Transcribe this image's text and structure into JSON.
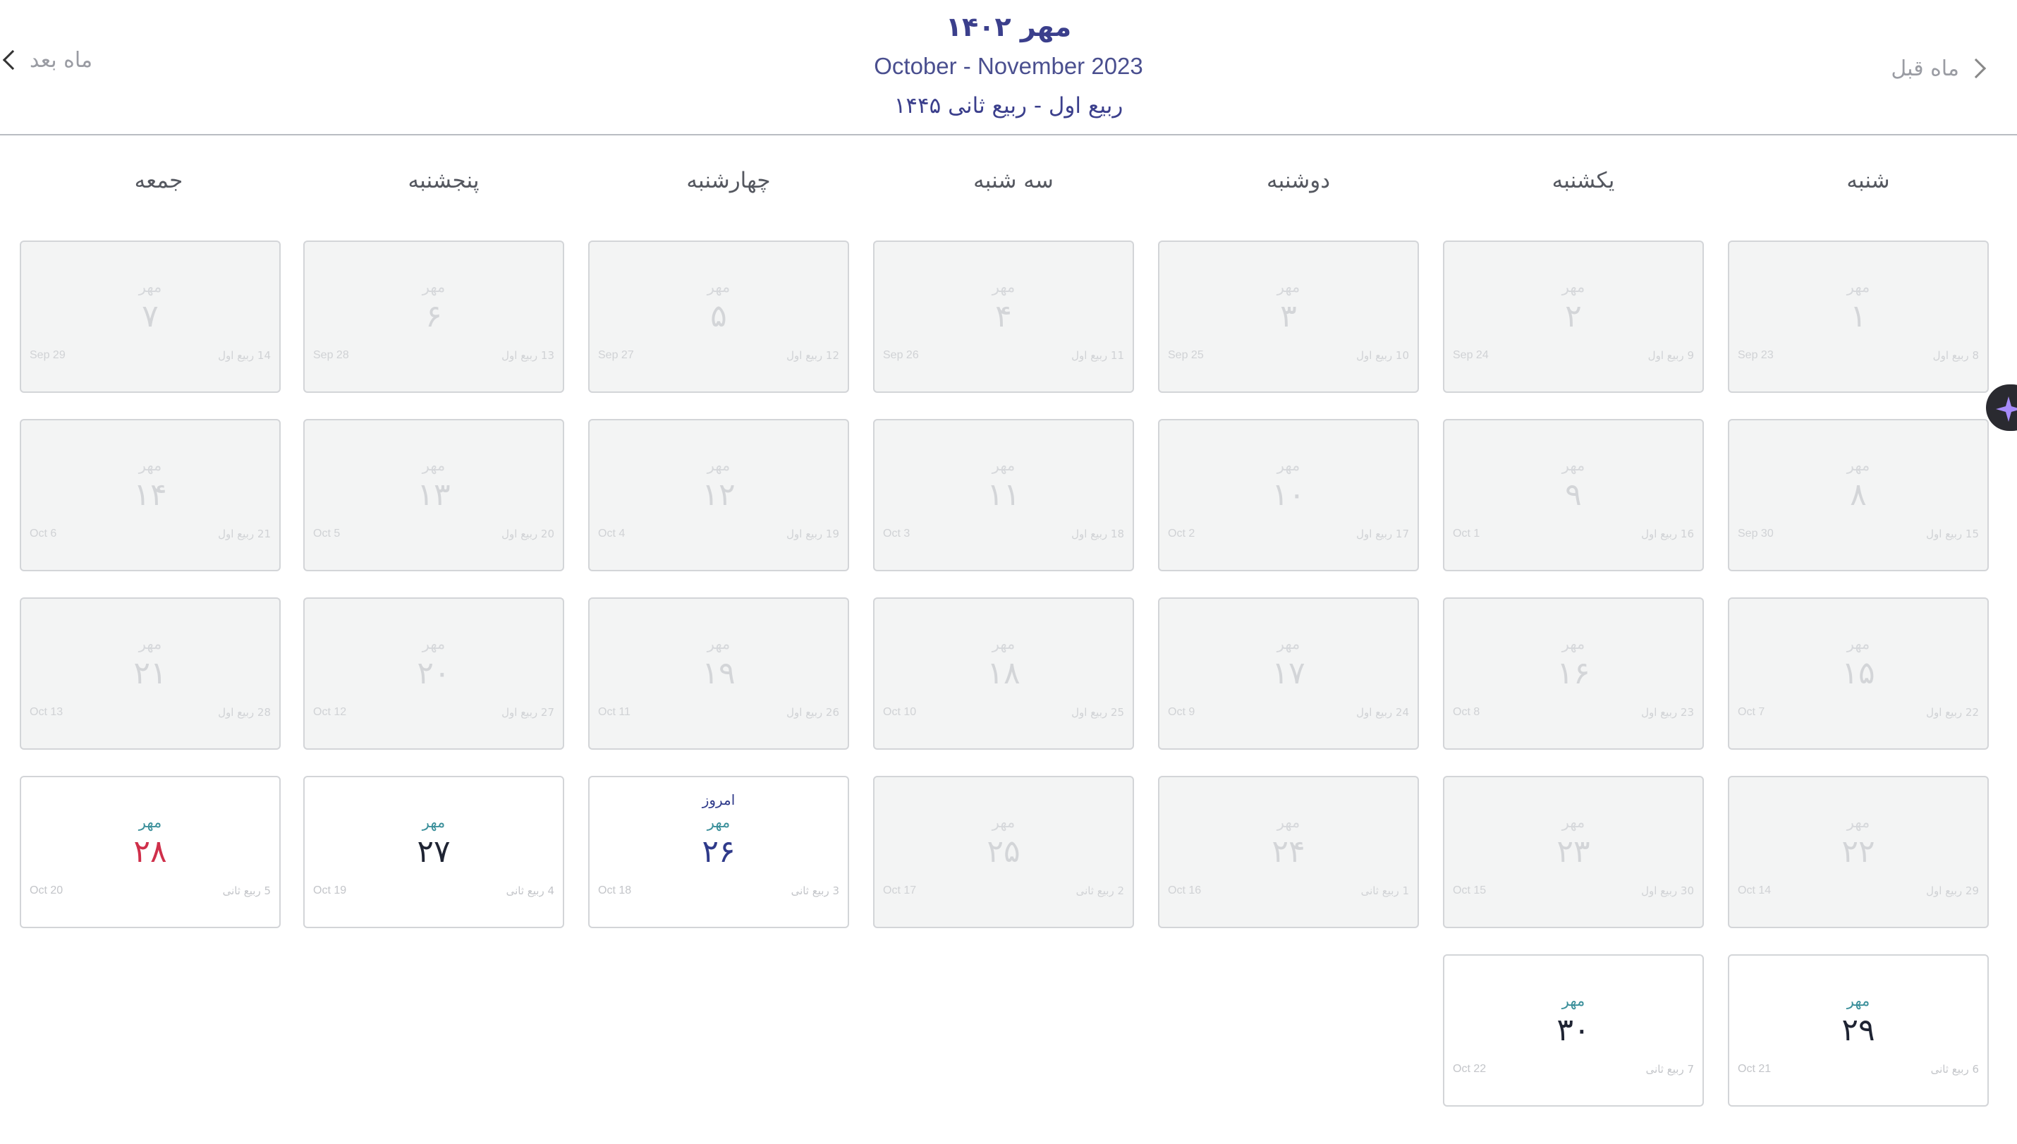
{
  "header": {
    "persian_title": "مهر ۱۴۰۲",
    "gregorian_range": "October - November 2023",
    "hijri_range": "ربیع اول - ربیع ثانی ۱۴۴۵",
    "next_month_label": "ماه بعد",
    "prev_month_label": "ماه قبل"
  },
  "weekdays": [
    "شنبه",
    "یکشنبه",
    "دوشنبه",
    "سه شنبه",
    "چهارشنبه",
    "پنجشنبه",
    "جمعه"
  ],
  "month_name": "مهر",
  "today_label": "امروز",
  "fab_icon": "sparkle-icon",
  "colors": {
    "accent": "#2f3a8a",
    "month_label": "#3a8f9a",
    "holiday": "#cf2f4a",
    "past_bg": "#f3f4f4"
  },
  "days": [
    {
      "day": "۱",
      "greg": "Sep 23",
      "hijri": "8 ربیع اول",
      "past": true
    },
    {
      "day": "۲",
      "greg": "Sep 24",
      "hijri": "9 ربیع اول",
      "past": true
    },
    {
      "day": "۳",
      "greg": "Sep 25",
      "hijri": "10 ربیع اول",
      "past": true
    },
    {
      "day": "۴",
      "greg": "Sep 26",
      "hijri": "11 ربیع اول",
      "past": true
    },
    {
      "day": "۵",
      "greg": "Sep 27",
      "hijri": "12 ربیع اول",
      "past": true
    },
    {
      "day": "۶",
      "greg": "Sep 28",
      "hijri": "13 ربیع اول",
      "past": true
    },
    {
      "day": "۷",
      "greg": "Sep 29",
      "hijri": "14 ربیع اول",
      "past": true
    },
    {
      "day": "۸",
      "greg": "Sep 30",
      "hijri": "15 ربیع اول",
      "past": true
    },
    {
      "day": "۹",
      "greg": "Oct 1",
      "hijri": "16 ربیع اول",
      "past": true
    },
    {
      "day": "۱۰",
      "greg": "Oct 2",
      "hijri": "17 ربیع اول",
      "past": true
    },
    {
      "day": "۱۱",
      "greg": "Oct 3",
      "hijri": "18 ربیع اول",
      "past": true
    },
    {
      "day": "۱۲",
      "greg": "Oct 4",
      "hijri": "19 ربیع اول",
      "past": true
    },
    {
      "day": "۱۳",
      "greg": "Oct 5",
      "hijri": "20 ربیع اول",
      "past": true
    },
    {
      "day": "۱۴",
      "greg": "Oct 6",
      "hijri": "21 ربیع اول",
      "past": true
    },
    {
      "day": "۱۵",
      "greg": "Oct 7",
      "hijri": "22 ربیع اول",
      "past": true
    },
    {
      "day": "۱۶",
      "greg": "Oct 8",
      "hijri": "23 ربیع اول",
      "past": true
    },
    {
      "day": "۱۷",
      "greg": "Oct 9",
      "hijri": "24 ربیع اول",
      "past": true
    },
    {
      "day": "۱۸",
      "greg": "Oct 10",
      "hijri": "25 ربیع اول",
      "past": true
    },
    {
      "day": "۱۹",
      "greg": "Oct 11",
      "hijri": "26 ربیع اول",
      "past": true
    },
    {
      "day": "۲۰",
      "greg": "Oct 12",
      "hijri": "27 ربیع اول",
      "past": true
    },
    {
      "day": "۲۱",
      "greg": "Oct 13",
      "hijri": "28 ربیع اول",
      "past": true
    },
    {
      "day": "۲۲",
      "greg": "Oct 14",
      "hijri": "29 ربیع اول",
      "past": true
    },
    {
      "day": "۲۳",
      "greg": "Oct 15",
      "hijri": "30 ربیع اول",
      "past": true
    },
    {
      "day": "۲۴",
      "greg": "Oct 16",
      "hijri": "1 ربیع ثانی",
      "past": true
    },
    {
      "day": "۲۵",
      "greg": "Oct 17",
      "hijri": "2 ربیع ثانی",
      "past": true
    },
    {
      "day": "۲۶",
      "greg": "Oct 18",
      "hijri": "3 ربیع ثانی",
      "past": false,
      "today": true
    },
    {
      "day": "۲۷",
      "greg": "Oct 19",
      "hijri": "4 ربیع ثانی",
      "past": false
    },
    {
      "day": "۲۸",
      "greg": "Oct 20",
      "hijri": "5 ربیع ثانی",
      "past": false,
      "holiday": true
    },
    {
      "day": "۲۹",
      "greg": "Oct 21",
      "hijri": "6 ربیع ثانی",
      "past": false
    },
    {
      "day": "۳۰",
      "greg": "Oct 22",
      "hijri": "7 ربیع ثانی",
      "past": false
    }
  ]
}
